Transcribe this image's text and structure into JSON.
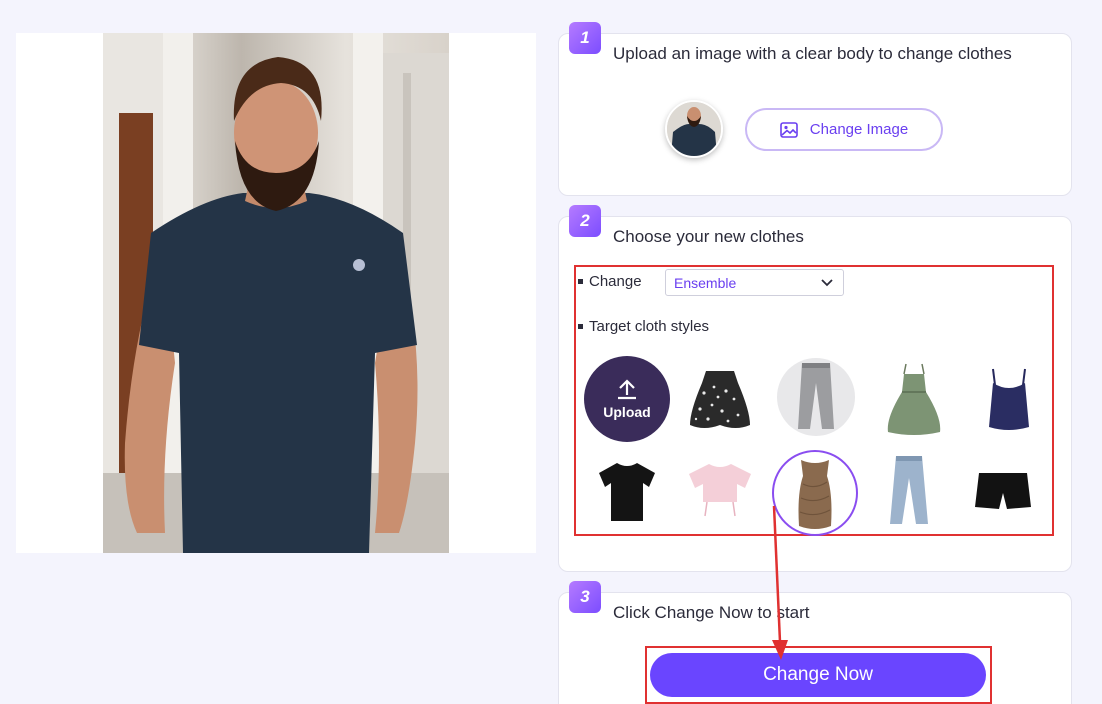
{
  "steps": [
    {
      "number": "1",
      "title": "Upload an image with a clear body to change clothes"
    },
    {
      "number": "2",
      "title": "Choose your new clothes"
    },
    {
      "number": "3",
      "title": "Click Change Now to start"
    }
  ],
  "upload_step": {
    "change_image_label": "Change Image",
    "thumbnail_icon": "uploaded-person-thumbnail"
  },
  "clothes_step": {
    "change_label": "Change",
    "change_select_value": "Ensemble",
    "target_label": "Target cloth styles",
    "upload_label": "Upload",
    "styles": [
      {
        "name": "floral-skirt",
        "selected": false
      },
      {
        "name": "grey-jeans",
        "selected": false
      },
      {
        "name": "green-dress",
        "selected": false
      },
      {
        "name": "navy-tank-top",
        "selected": false
      },
      {
        "name": "black-tshirt",
        "selected": false
      },
      {
        "name": "pink-crop-top",
        "selected": false
      },
      {
        "name": "brown-bodycon-dress",
        "selected": true
      },
      {
        "name": "blue-jeans",
        "selected": false
      },
      {
        "name": "black-shorts",
        "selected": false
      }
    ]
  },
  "action_step": {
    "button_label": "Change Now"
  },
  "colors": {
    "accent": "#6a45ff",
    "highlight": "#e03131",
    "badge_start": "#b57bff",
    "badge_end": "#7c4dff"
  }
}
